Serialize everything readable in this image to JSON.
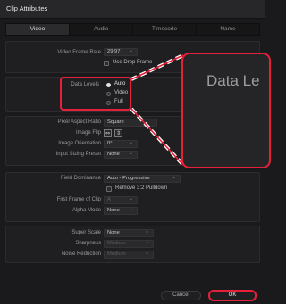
{
  "window": {
    "title": "Clip Attributes"
  },
  "tabs": [
    {
      "label": "Video",
      "active": true
    },
    {
      "label": "Audio",
      "active": false
    },
    {
      "label": "Timecode",
      "active": false
    },
    {
      "label": "Name",
      "active": false
    }
  ],
  "video_frame_rate": {
    "label": "Video Frame Rate",
    "value": "29.97",
    "use_drop_frame_label": "Use Drop Frame"
  },
  "data_levels": {
    "label": "Data Levels",
    "options": [
      "Auto",
      "Video",
      "Full"
    ],
    "selected": "Auto"
  },
  "zoom_callout": {
    "text": "Data Le"
  },
  "pixel_aspect_ratio": {
    "label": "Pixel Aspect Ratio",
    "value": "Square"
  },
  "image_flip": {
    "label": "Image Flip"
  },
  "image_orientation": {
    "label": "Image Orientation",
    "value": "0°"
  },
  "input_sizing_preset": {
    "label": "Input Sizing Preset",
    "value": "None"
  },
  "field_dominance": {
    "label": "Field Dominance",
    "value": "Auto - Progressive",
    "remove_pulldown_label": "Remove 3:2 Pulldown"
  },
  "first_frame_of_clip": {
    "label": "First Frame of Clip",
    "value": "A"
  },
  "alpha_mode": {
    "label": "Alpha Mode",
    "value": "None"
  },
  "super_scale": {
    "label": "Super Scale",
    "value": "None"
  },
  "sharpness": {
    "label": "Sharpness",
    "value": "Medium"
  },
  "noise_reduction": {
    "label": "Noise Reduction",
    "value": "Medium"
  },
  "footer": {
    "cancel_label": "Cancel",
    "ok_label": "OK"
  },
  "colors": {
    "accent": "#e4203b",
    "background": "#1a1a1c",
    "panel": "#1f1f21"
  }
}
